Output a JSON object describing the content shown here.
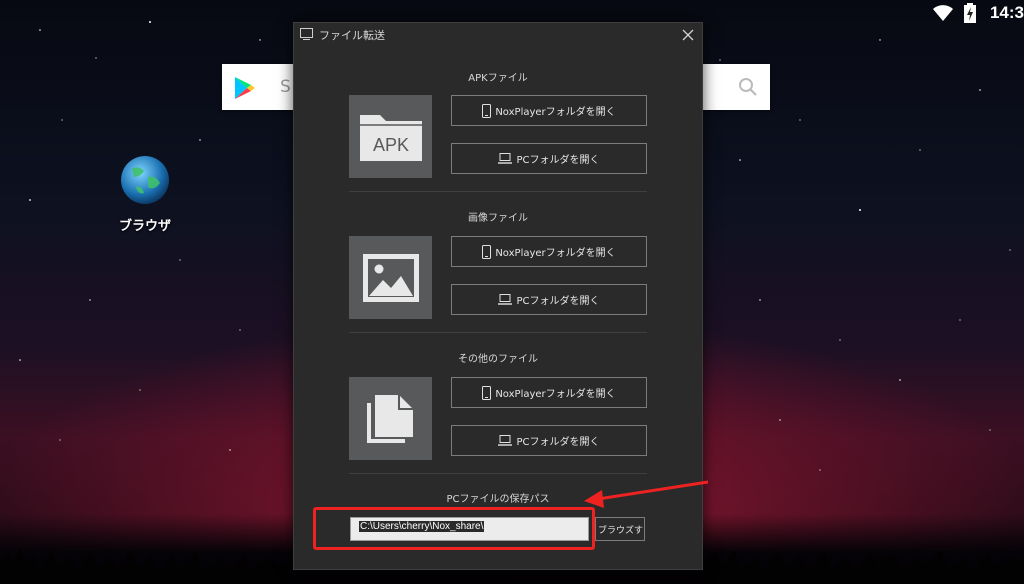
{
  "status_bar": {
    "time": "14:3"
  },
  "desktop": {
    "search_hint": "S",
    "browser_label": "ブラウザ"
  },
  "dialog": {
    "title": "ファイル転送",
    "sections": [
      {
        "title": "APKファイル",
        "thumb_label": "APK",
        "nox_btn": "NoxPlayerフォルダを開く",
        "pc_btn": "PCフォルダを開く"
      },
      {
        "title": "画像ファイル",
        "nox_btn": "NoxPlayerフォルダを開く",
        "pc_btn": "PCフォルダを開く"
      },
      {
        "title": "その他のファイル",
        "nox_btn": "NoxPlayerフォルダを開く",
        "pc_btn": "PCフォルダを開く"
      }
    ],
    "save_path_label": "PCファイルの保存パス",
    "save_path_value": "C:\\Users\\cherry\\Nox_share\\",
    "browse_btn": "ブラウズする"
  },
  "colors": {
    "annotation": "#ef2222",
    "dialog_bg": "#2a2a2b",
    "thumb_bg": "#58595b"
  }
}
